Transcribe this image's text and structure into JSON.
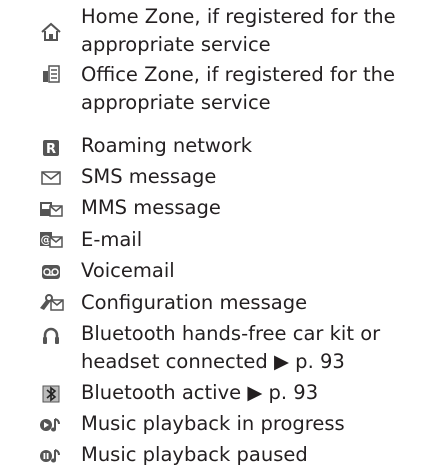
{
  "items": [
    {
      "icon": "home-zone-icon",
      "line1": "Home Zone, if registered for the",
      "line2": "appropriate service"
    },
    {
      "icon": "office-zone-icon",
      "line1": "Office Zone, if registered for the",
      "line2": "appropriate service"
    },
    {
      "icon": "roaming-icon",
      "line1": "Roaming network"
    },
    {
      "icon": "sms-envelope-icon",
      "line1": "SMS message"
    },
    {
      "icon": "mms-icon",
      "line1": "MMS message"
    },
    {
      "icon": "email-icon",
      "line1": "E-mail"
    },
    {
      "icon": "voicemail-icon",
      "line1": "Voicemail"
    },
    {
      "icon": "configuration-message-icon",
      "line1": "Configuration message"
    },
    {
      "icon": "headset-icon",
      "line1": "Bluetooth hands-free car kit or",
      "line2": "headset connected ▶ p. 93"
    },
    {
      "icon": "bluetooth-icon",
      "line1": "Bluetooth active ▶ p. 93"
    },
    {
      "icon": "music-playing-icon",
      "line1": "Music playback in progress"
    },
    {
      "icon": "music-paused-icon",
      "line1": "Music playback paused"
    }
  ]
}
